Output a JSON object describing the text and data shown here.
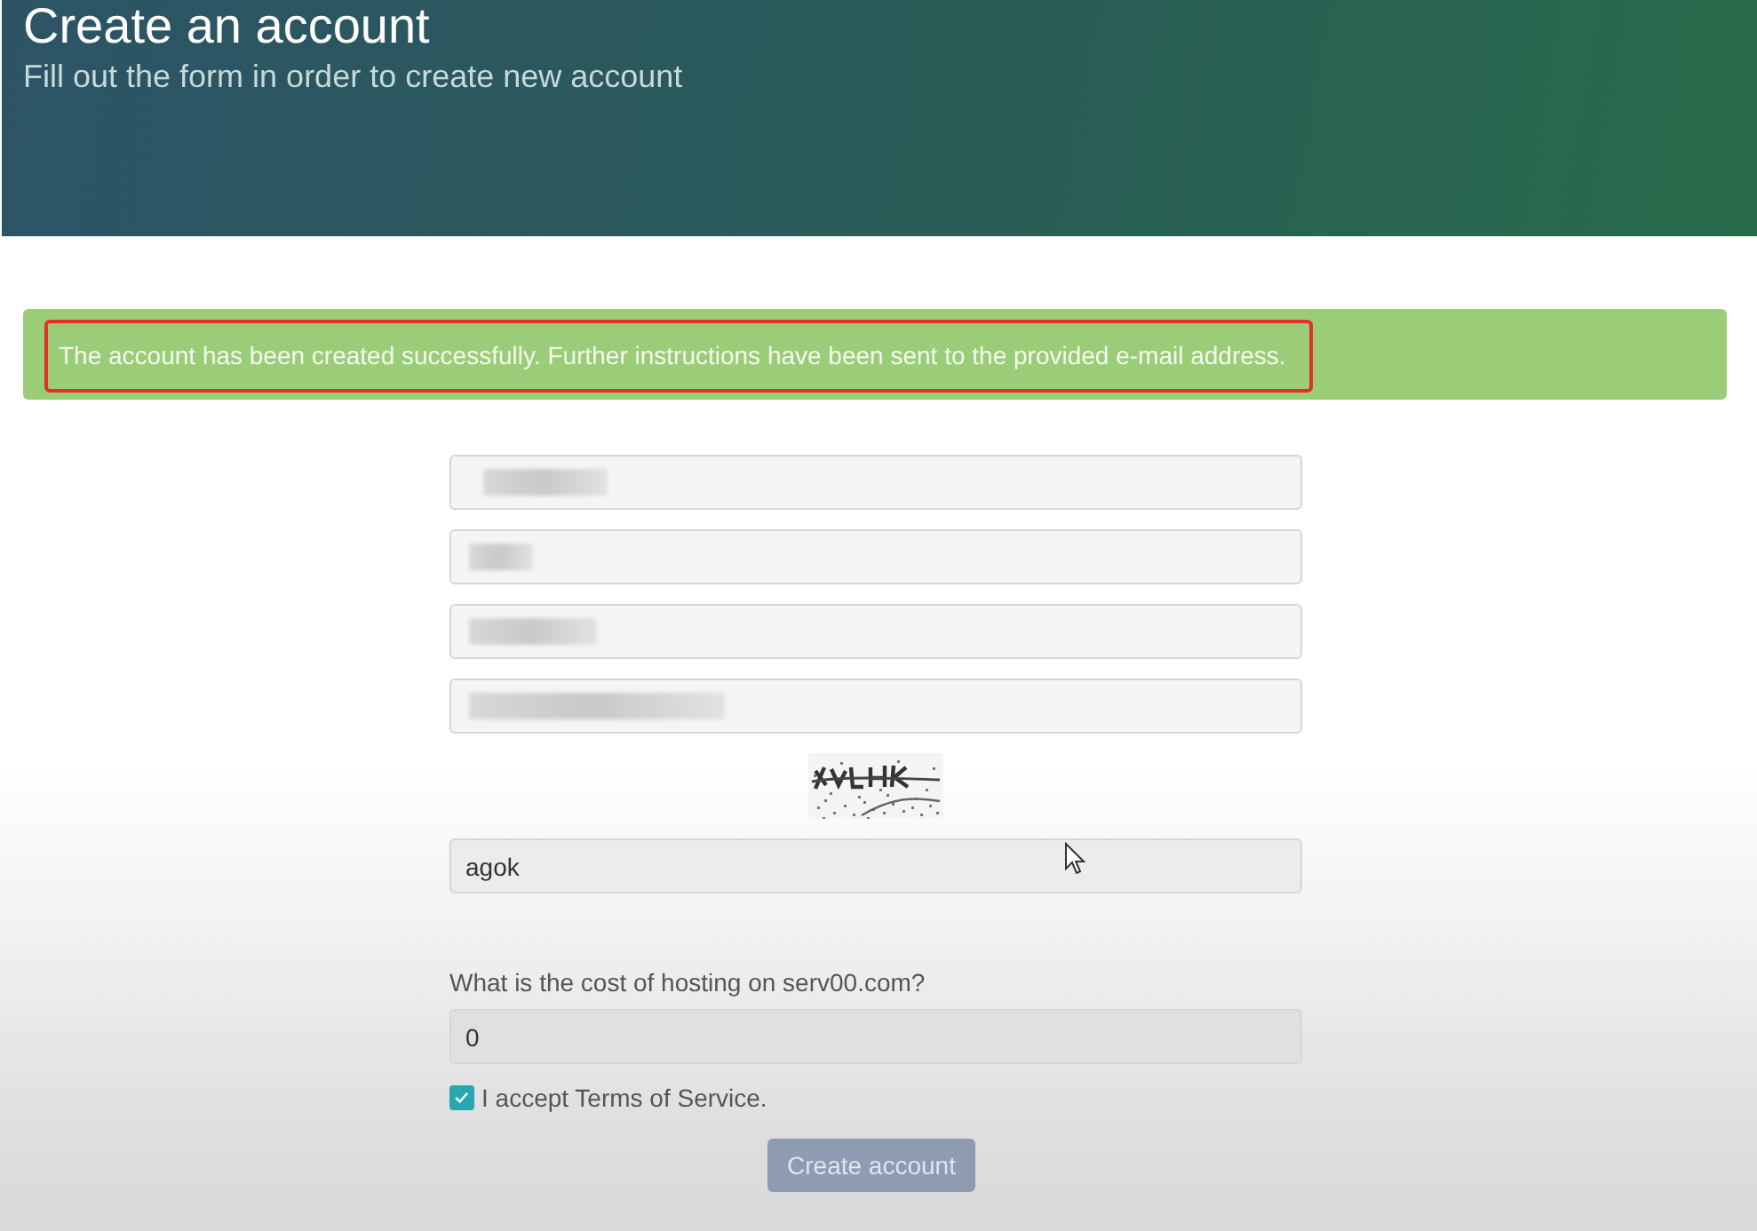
{
  "header": {
    "title": "Create an account",
    "subtitle": "Fill out the form in order to create new account"
  },
  "alert": {
    "message": "The account has been created successfully. Further instructions have been sent to the provided e-mail address.",
    "highlighted": true
  },
  "form": {
    "fields": [
      {
        "redacted": true
      },
      {
        "redacted": true
      },
      {
        "redacted": true
      },
      {
        "redacted": true
      }
    ],
    "captcha": {
      "value": "agok"
    },
    "question": {
      "label": "What is the cost of hosting on serv00.com?",
      "value": "0"
    },
    "terms": {
      "label": "I accept Terms of Service.",
      "checked": true
    },
    "submit": {
      "label": "Create account"
    }
  }
}
